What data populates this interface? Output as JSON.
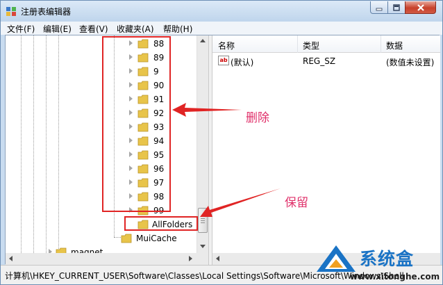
{
  "window": {
    "title": "注册表编辑器"
  },
  "menu": [
    {
      "label": "文件(F)"
    },
    {
      "label": "编辑(E)"
    },
    {
      "label": "查看(V)"
    },
    {
      "label": "收藏夹(A)"
    },
    {
      "label": "帮助(H)"
    }
  ],
  "tree": {
    "numbered_keys": [
      "88",
      "89",
      "9",
      "90",
      "91",
      "92",
      "93",
      "94",
      "95",
      "96",
      "97",
      "98",
      "99"
    ],
    "allfolders": "AllFolders",
    "muicache": "MuiCache",
    "partial_bottom": "magnet"
  },
  "list": {
    "columns": [
      "名称",
      "类型",
      "数据"
    ],
    "rows": [
      {
        "name": "(默认)",
        "type": "REG_SZ",
        "data": "(数值未设置)"
      }
    ]
  },
  "status": {
    "path": "计算机\\HKEY_CURRENT_USER\\Software\\Classes\\Local Settings\\Software\\Microsoft\\Windows\\Shell"
  },
  "annotations": {
    "delete_label": "删除",
    "keep_label": "保留",
    "color": "#e02424"
  },
  "watermark": {
    "brand": "系统盒",
    "url": "www.xitonghe.com"
  },
  "colors": {
    "folder": "#e8c44a",
    "titlebar": "#c9dcf0"
  }
}
